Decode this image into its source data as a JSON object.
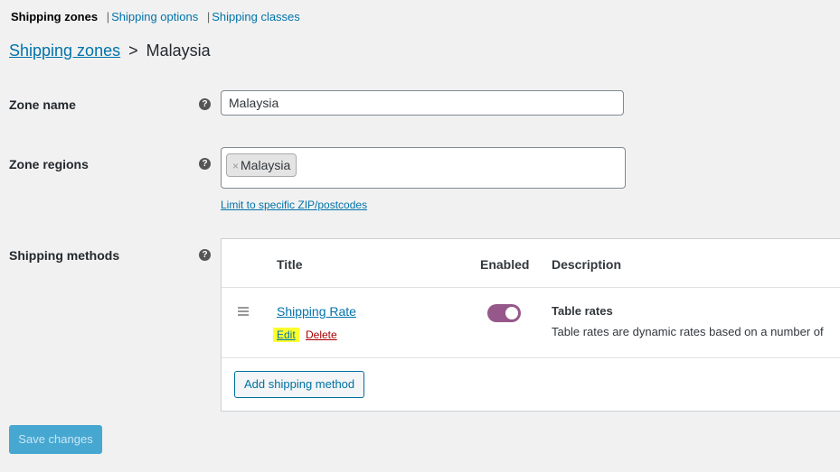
{
  "subnav": {
    "current": "Shipping zones",
    "separator": "|",
    "options_label": "Shipping options",
    "classes_label": "Shipping classes"
  },
  "breadcrumb": {
    "parent": "Shipping zones",
    "separator": ">",
    "current": "Malaysia"
  },
  "zone_name": {
    "label": "Zone name",
    "value": "Malaysia"
  },
  "zone_regions": {
    "label": "Zone regions",
    "chip_remove": "×",
    "chip": "Malaysia",
    "limit_link": "Limit to specific ZIP/postcodes"
  },
  "help_glyph": "?",
  "shipping_methods": {
    "label": "Shipping methods",
    "columns": {
      "title": "Title",
      "enabled": "Enabled",
      "description": "Description"
    },
    "rows": [
      {
        "title": "Shipping Rate",
        "edit": "Edit",
        "delete": "Delete",
        "enabled": true,
        "desc_title": "Table rates",
        "desc_text": "Table rates are dynamic rates based on a number of"
      }
    ],
    "add_button": "Add shipping method"
  },
  "save_button": "Save changes",
  "colors": {
    "link": "#0073aa",
    "toggle_on": "#96588a",
    "highlight": "#ffff2e",
    "delete": "#aa0000",
    "save_bg": "#46a7d1"
  }
}
